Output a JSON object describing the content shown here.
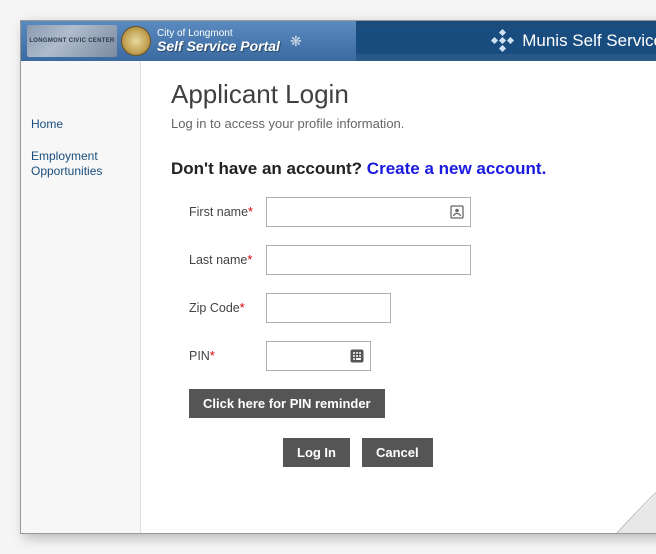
{
  "header": {
    "banner_line1": "City of Longmont",
    "banner_line2": "Self Service Portal",
    "civic_img_text": "LONGMONT CIVIC CENTER",
    "product_name": "Munis Self Service"
  },
  "sidebar": {
    "items": [
      {
        "label": "Home"
      },
      {
        "label": "Employment Opportunities"
      }
    ]
  },
  "main": {
    "title": "Applicant Login",
    "subtitle": "Log in to access your profile information.",
    "prompt_static": "Don't have an account? ",
    "prompt_link": "Create a new account.",
    "fields": {
      "first_name": {
        "label": "First name",
        "value": ""
      },
      "last_name": {
        "label": "Last name",
        "value": ""
      },
      "zip": {
        "label": "Zip Code",
        "value": ""
      },
      "pin": {
        "label": "PIN",
        "value": ""
      }
    },
    "buttons": {
      "pin_reminder": "Click here for PIN reminder",
      "login": "Log In",
      "cancel": "Cancel"
    }
  }
}
